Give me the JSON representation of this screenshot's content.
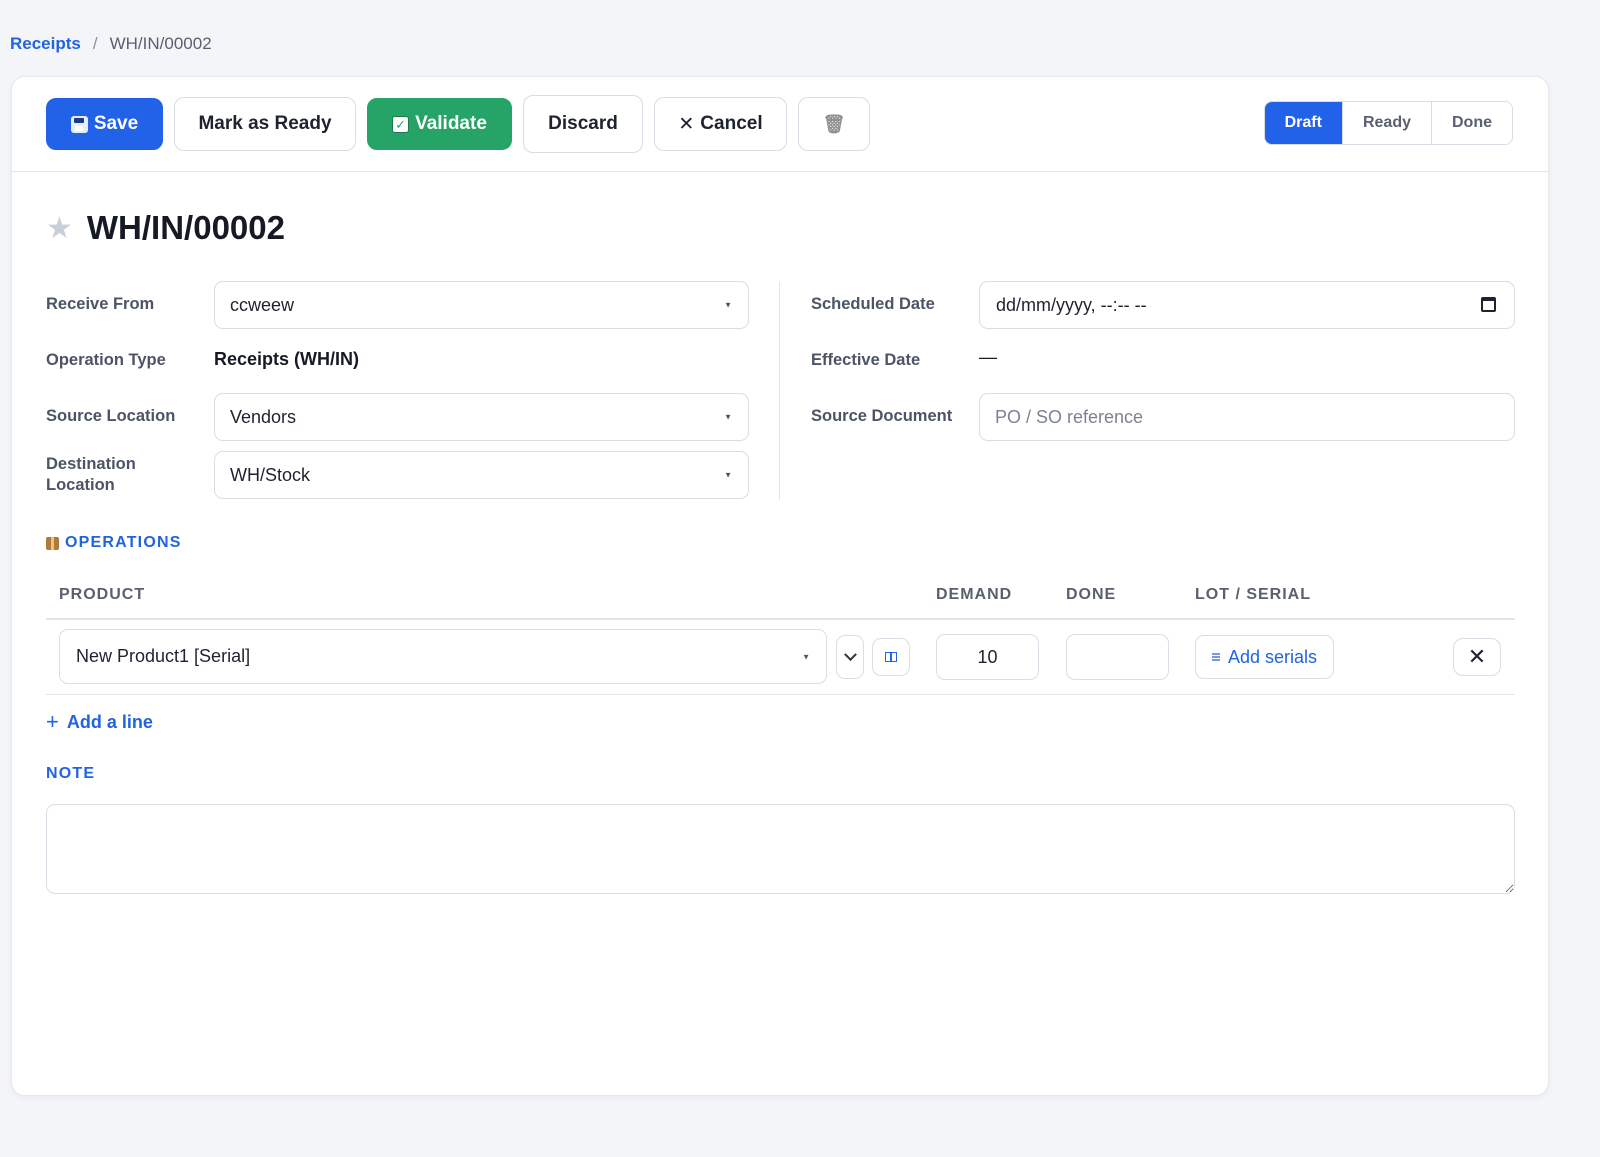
{
  "breadcrumb": {
    "parent": "Receipts",
    "separator": "/",
    "current": "WH/IN/00002"
  },
  "toolbar": {
    "save_label": "Save",
    "mark_ready_label": "Mark as Ready",
    "validate_label": "Validate",
    "discard_label": "Discard",
    "cancel_label": "Cancel",
    "cancel_glyph": "✕",
    "trash_glyph": "🗑"
  },
  "status": {
    "steps": [
      "Draft",
      "Ready",
      "Done"
    ],
    "active": "Draft"
  },
  "record": {
    "title": "WH/IN/00002",
    "star_glyph": "★"
  },
  "fields": {
    "receive_from": {
      "label": "Receive From",
      "value": "ccweew"
    },
    "operation_type": {
      "label": "Operation Type",
      "value": "Receipts (WH/IN)"
    },
    "source_location": {
      "label": "Source Location",
      "value": "Vendors"
    },
    "destination_location": {
      "label_line1": "Destination",
      "label_line2": "Location",
      "value": "WH/Stock"
    },
    "scheduled_date": {
      "label": "Scheduled Date",
      "value": "dd/mm/yyyy, --:-- --"
    },
    "effective_date": {
      "label": "Effective Date",
      "value": "—"
    },
    "source_document": {
      "label": "Source Document",
      "placeholder": "PO / SO reference",
      "value": ""
    }
  },
  "operations": {
    "section_title": "OPERATIONS",
    "columns": {
      "product": "PRODUCT",
      "demand": "DEMAND",
      "done": "DONE",
      "lot_serial": "LOT / SERIAL"
    },
    "rows": [
      {
        "product": "New Product1 [Serial]",
        "demand": "10",
        "done": "",
        "lot_action": "Add serials",
        "remove_glyph": "✕"
      }
    ],
    "add_line_label": "Add a line",
    "add_line_glyph": "+"
  },
  "note": {
    "section_title": "NOTE",
    "value": ""
  },
  "colors": {
    "primary": "#2262e8",
    "success": "#26a366",
    "link": "#2263df"
  }
}
